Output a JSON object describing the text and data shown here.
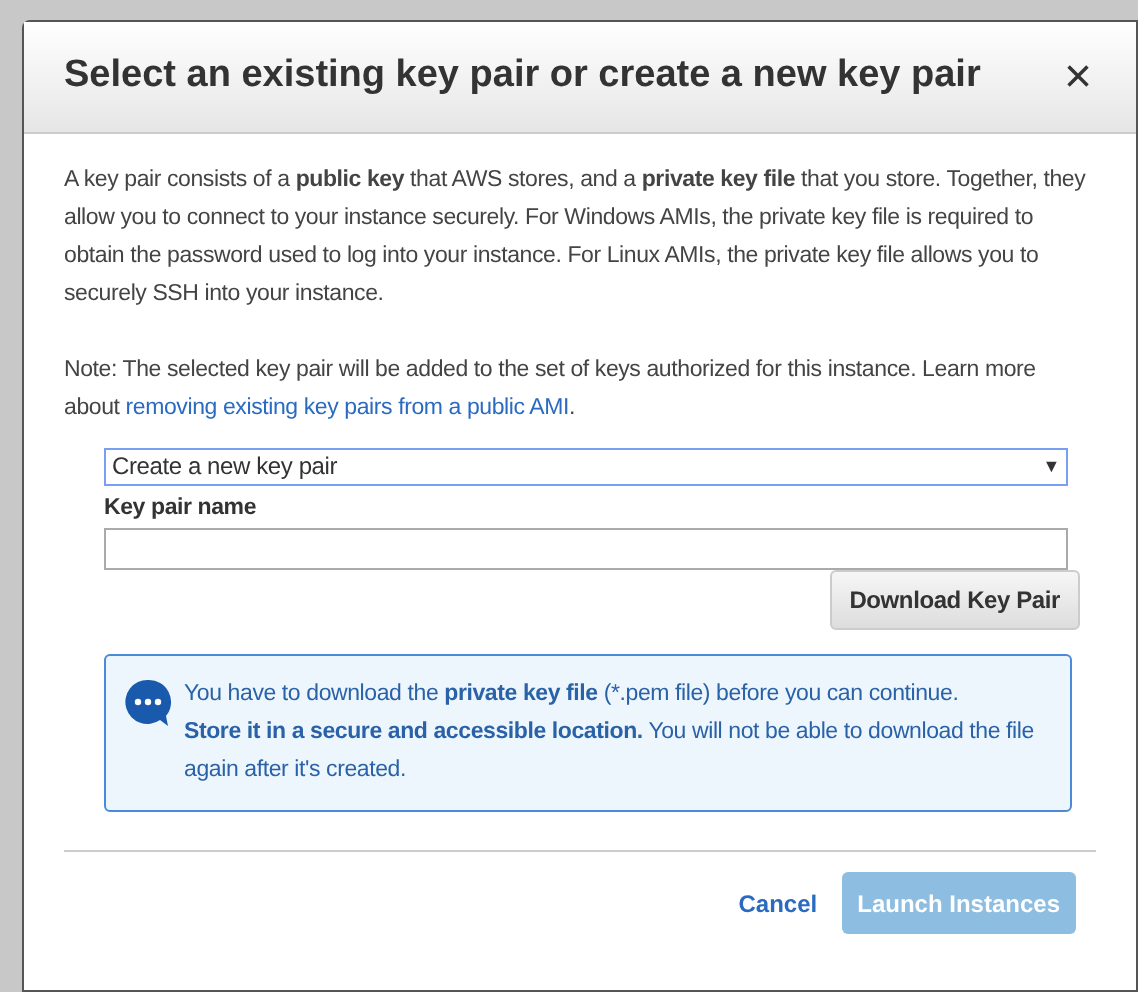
{
  "dialog": {
    "title": "Select an existing key pair or create a new key pair",
    "close": "×",
    "intro": "A key pair consists of a **public key** that AWS stores, and a **private key file** that you store. Together, they allow you to connect to your instance securely. For Windows AMIs, the private key file is required to obtain the password used to log into your instance. For Linux AMIs, the private key file allows you to securely SSH into your instance.",
    "note": "Note: The selected key pair will be added to the set of keys authorized for this instance. Learn more about",
    "note_link": "removing existing key pairs from a public AMI",
    "note_end": ".",
    "select": {
      "value": "Create a new key pair",
      "arrow": "▼"
    },
    "key_name_label": "Key pair name",
    "download_button": "Download Key Pair",
    "info": {
      "line1": "You have to download the **private key file** (*.pem file) before you can continue.",
      "line2": "**Store it in a secure and accessible location.** You will not be able to download the file again after it's created."
    },
    "buttons": [
      {
        "label": "Cancel",
        "kind": "link",
        "disabled": false
      },
      {
        "label": "Launch Instances",
        "kind": "primary",
        "disabled": true
      }
    ]
  }
}
